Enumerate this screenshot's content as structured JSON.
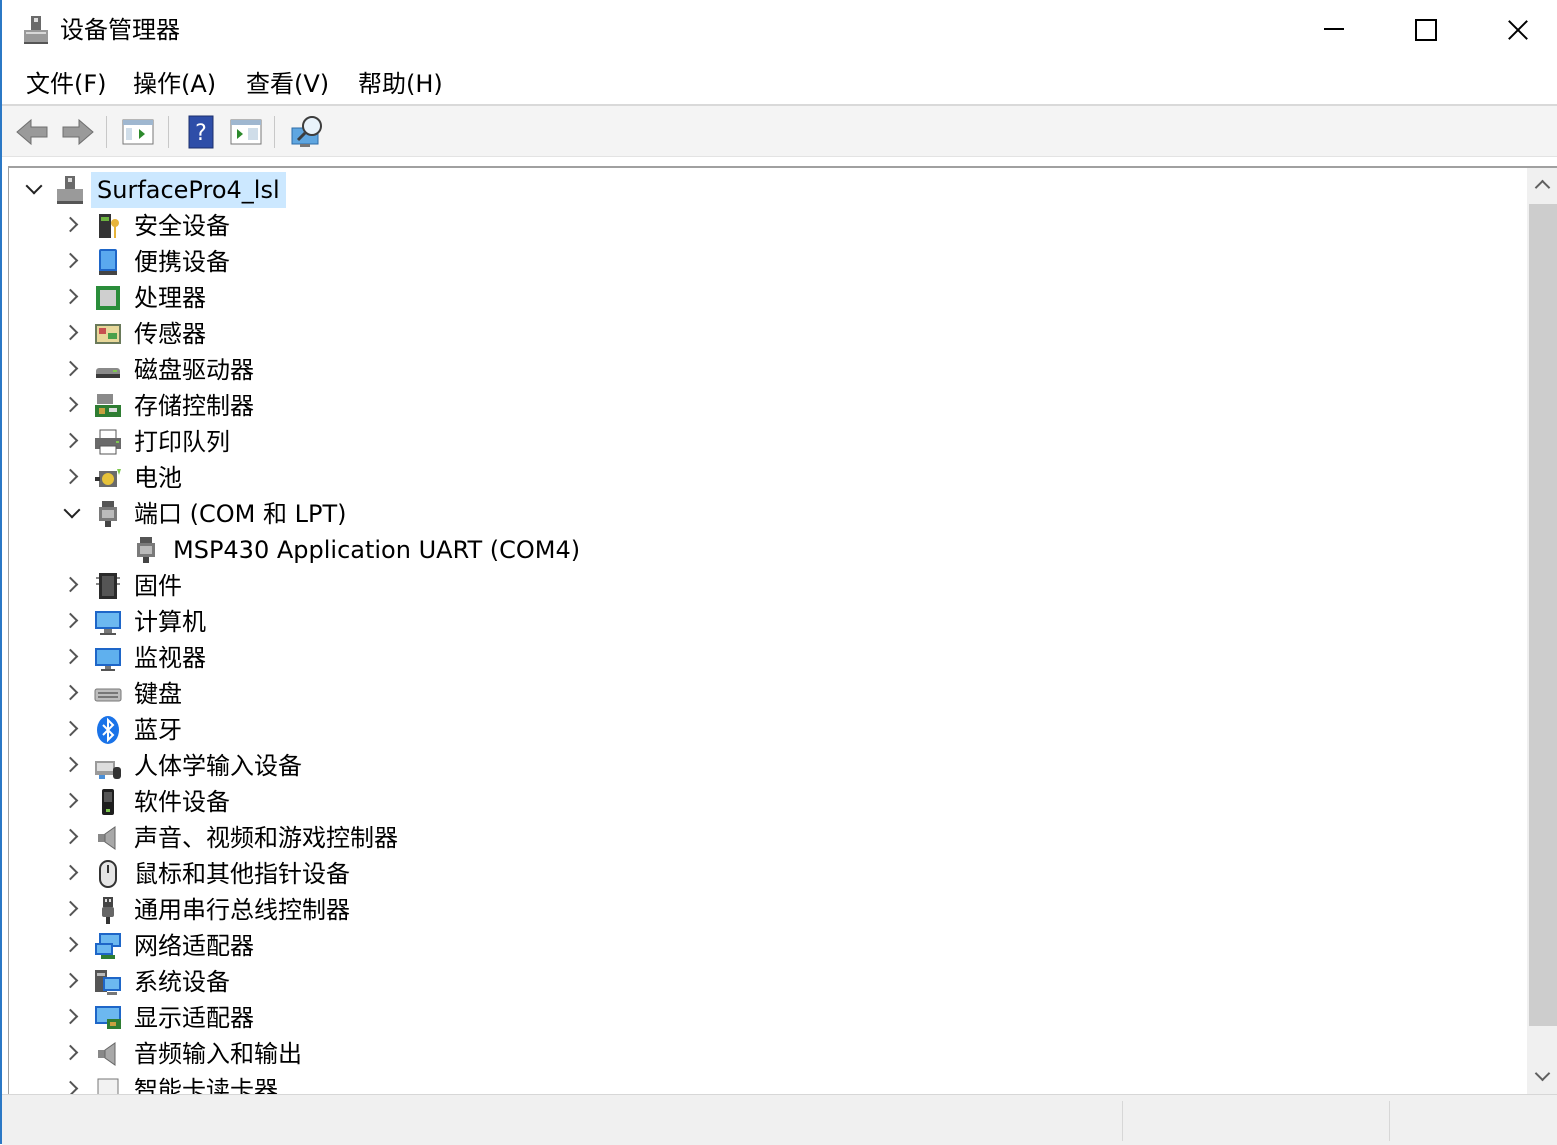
{
  "window": {
    "title": "设备管理器"
  },
  "menu": [
    "文件(F)",
    "操作(A)",
    "查看(V)",
    "帮助(H)"
  ],
  "toolbar": [
    "back-icon",
    "forward-icon",
    "properties-icon",
    "help-icon",
    "update-driver-icon",
    "scan-hardware-icon"
  ],
  "tree": {
    "root": "SurfacePro4_lsl",
    "categories": [
      {
        "label": "安全设备",
        "icon": "security-device-icon",
        "expanded": false
      },
      {
        "label": "便携设备",
        "icon": "portable-device-icon",
        "expanded": false
      },
      {
        "label": "处理器",
        "icon": "processor-icon",
        "expanded": false
      },
      {
        "label": "传感器",
        "icon": "sensor-icon",
        "expanded": false
      },
      {
        "label": "磁盘驱动器",
        "icon": "disk-drive-icon",
        "expanded": false
      },
      {
        "label": "存储控制器",
        "icon": "storage-controller-icon",
        "expanded": false
      },
      {
        "label": "打印队列",
        "icon": "printer-icon",
        "expanded": false
      },
      {
        "label": "电池",
        "icon": "battery-icon",
        "expanded": false
      },
      {
        "label": "端口 (COM 和 LPT)",
        "icon": "port-icon",
        "expanded": true,
        "children": [
          {
            "label": "MSP430 Application UART (COM4)",
            "icon": "port-icon"
          }
        ]
      },
      {
        "label": "固件",
        "icon": "firmware-icon",
        "expanded": false
      },
      {
        "label": "计算机",
        "icon": "computer-icon",
        "expanded": false
      },
      {
        "label": "监视器",
        "icon": "monitor-icon",
        "expanded": false
      },
      {
        "label": "键盘",
        "icon": "keyboard-icon",
        "expanded": false
      },
      {
        "label": "蓝牙",
        "icon": "bluetooth-icon",
        "expanded": false
      },
      {
        "label": "人体学输入设备",
        "icon": "hid-icon",
        "expanded": false
      },
      {
        "label": "软件设备",
        "icon": "software-device-icon",
        "expanded": false
      },
      {
        "label": "声音、视频和游戏控制器",
        "icon": "speaker-icon",
        "expanded": false
      },
      {
        "label": "鼠标和其他指针设备",
        "icon": "mouse-icon",
        "expanded": false
      },
      {
        "label": "通用串行总线控制器",
        "icon": "usb-icon",
        "expanded": false
      },
      {
        "label": "网络适配器",
        "icon": "network-adapter-icon",
        "expanded": false
      },
      {
        "label": "系统设备",
        "icon": "system-device-icon",
        "expanded": false
      },
      {
        "label": "显示适配器",
        "icon": "display-adapter-icon",
        "expanded": false
      },
      {
        "label": "音频输入和输出",
        "icon": "audio-io-icon",
        "expanded": false
      },
      {
        "label": "智能卡读卡器",
        "icon": "smart-card-reader-icon",
        "expanded": false
      }
    ]
  },
  "colors": {
    "selection": "#cce8ff",
    "border": "#2b78c5"
  }
}
